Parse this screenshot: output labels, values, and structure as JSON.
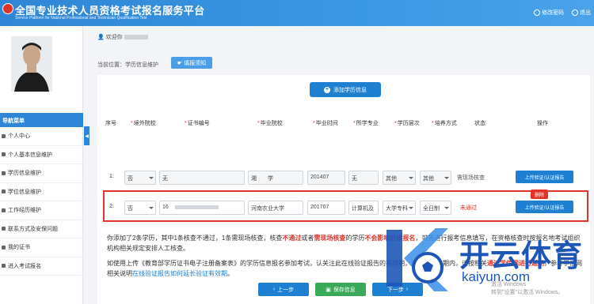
{
  "header": {
    "title": "全国专业技术人员资格考试报名服务平台",
    "subtitle": "Service Platform for National Professional and Technician Qualification Test",
    "links": [
      "修改密码",
      "退出"
    ]
  },
  "sidebar": {
    "nav_title": "导航菜单",
    "items": [
      "个人中心",
      "个人基本信息维护",
      "学历信息维护",
      "学位信息维护",
      "工作经历维护",
      "联系方式及安保问题",
      "我的证书",
      "进入考试报名"
    ]
  },
  "main": {
    "welcome": "欢迎你",
    "breadcrumb": "当前位置：学历信息维护",
    "help_button": "填报须知",
    "add_button": "添加学历信息",
    "table": {
      "headers": [
        "序号",
        "境外院校",
        "证书编号",
        "毕业院校",
        "毕业时间",
        "所学专业",
        "学历层次",
        "培养方式",
        "状态",
        "操作"
      ],
      "rows": [
        {
          "index": "1:",
          "overseas": "否",
          "cert": "无",
          "school": "湘　　学",
          "time": "201407",
          "major": "无",
          "level": "其他",
          "mode": "其他",
          "status": "需现场核查",
          "action": "上传验证/认证报告"
        },
        {
          "index": "2:",
          "overseas": "否",
          "cert": "16",
          "school": "河南农业大学",
          "time": "201707",
          "major": "计算机及",
          "level": "大学专科",
          "mode": "全日制",
          "status": "未通过",
          "action": "上传验证/认证报告",
          "delete": "删除"
        }
      ]
    },
    "note1": {
      "a": "你添加了2条学历，其中1条核查不通过，1条需现场核查，核查",
      "b": "不通过",
      "c": "或者",
      "d": "需现场核查",
      "e": "的学历",
      "f": "不会影响后续报名",
      "g": "，可先进行报考信息填写，在资格核查时按报名地考试组织机构相关规定安排人工核查。"
    },
    "note2": {
      "a": "如使用上传《教育部学历证书电子注册备案表》的学历信息报名参加考试，认关注此在线验证报告的有效期，若不在有效期内，请按相关",
      "b": "通过学信网进行延期",
      "c": "，参考学信网相关说明",
      "d": "在线验证报告如何延长验证有效期",
      "e": "。"
    },
    "buttons": {
      "prev": "上一步",
      "save": "保存信息",
      "next": "下一步"
    }
  },
  "watermark": {
    "brand": "开云体育",
    "url": "kaiyun.com"
  },
  "windows": {
    "line1": "激活 Windows",
    "line2": "转到\"设置\"以激活 Windows。"
  },
  "colors": {
    "primary": "#1f7fd1",
    "header": "#2f86d6",
    "danger": "#e0342b",
    "success": "#3aa95a"
  }
}
